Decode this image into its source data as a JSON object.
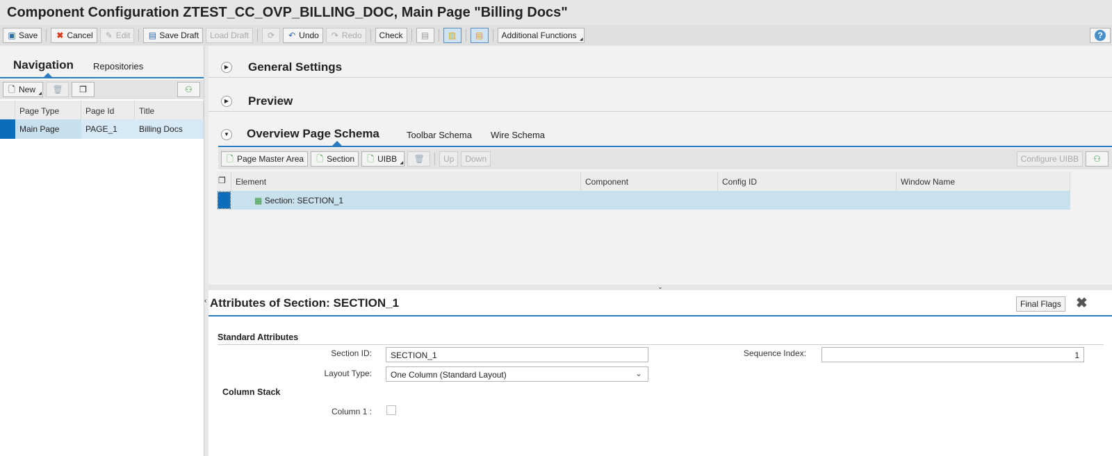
{
  "title": "Component Configuration ZTEST_CC_OVP_BILLING_DOC, Main Page \"Billing Docs\"",
  "toolbar": {
    "save": "Save",
    "cancel": "Cancel",
    "edit": "Edit",
    "save_draft": "Save Draft",
    "load_draft": "Load Draft",
    "undo": "Undo",
    "redo": "Redo",
    "check": "Check",
    "additional_functions": "Additional Functions",
    "help": "?"
  },
  "nav": {
    "tabs": [
      "Navigation",
      "Repositories"
    ],
    "new_label": "New",
    "columns": [
      "Page Type",
      "Page Id",
      "Title"
    ],
    "rows": [
      {
        "page_type": "Main Page",
        "page_id": "PAGE_1",
        "title": "Billing Docs"
      }
    ]
  },
  "panels": {
    "general": "General Settings",
    "preview": "Preview"
  },
  "schema": {
    "tabs": [
      "Overview Page Schema",
      "Toolbar Schema",
      "Wire Schema"
    ],
    "buttons": {
      "page_master_area": "Page Master Area",
      "section": "Section",
      "uibb": "UIBB",
      "up": "Up",
      "down": "Down",
      "configure_uibb": "Configure UIBB"
    },
    "columns": [
      "Element",
      "Component",
      "Config ID",
      "Window Name"
    ],
    "rows": [
      {
        "element": "Section: SECTION_1",
        "component": "",
        "config_id": "",
        "window_name": ""
      }
    ]
  },
  "attributes": {
    "title": "Attributes of Section: SECTION_1",
    "final_flags": "Final Flags",
    "standard_attributes": "Standard Attributes",
    "section_id_label": "Section ID:",
    "section_id": "SECTION_1",
    "sequence_index_label": "Sequence Index:",
    "sequence_index": "1",
    "layout_type_label": "Layout Type:",
    "layout_type": "One Column (Standard Layout)",
    "column_stack": "Column Stack",
    "column1_label": "Column 1 :",
    "column1_checked": false
  },
  "colors": {
    "accent": "#2b7bc0",
    "selection": "#cde3f1",
    "row_marker": "#0a6ebd"
  }
}
